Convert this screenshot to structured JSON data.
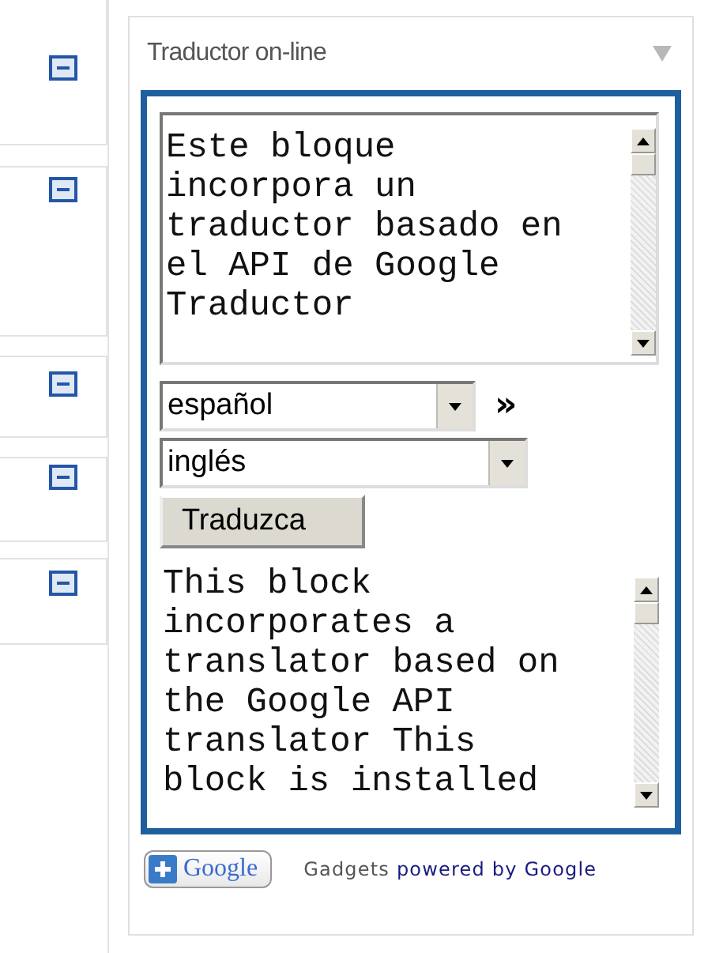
{
  "side_panels": [
    {
      "collapsed": false
    },
    {
      "collapsed": false
    },
    {
      "collapsed": false
    },
    {
      "collapsed": false
    },
    {
      "collapsed": false
    }
  ],
  "gadget": {
    "title": "Traductor on-line",
    "source_text": "Este bloque incorpora un traductor basado en el API de Google Traductor",
    "from_language": "español",
    "swap": "»",
    "to_language": "inglés",
    "button": "Traduzca",
    "result_text": "This block incorporates a translator based on the Google API translator This block is installed",
    "google_button": "Google",
    "footer": {
      "label": "Gadgets",
      "link": "powered by Google"
    }
  }
}
